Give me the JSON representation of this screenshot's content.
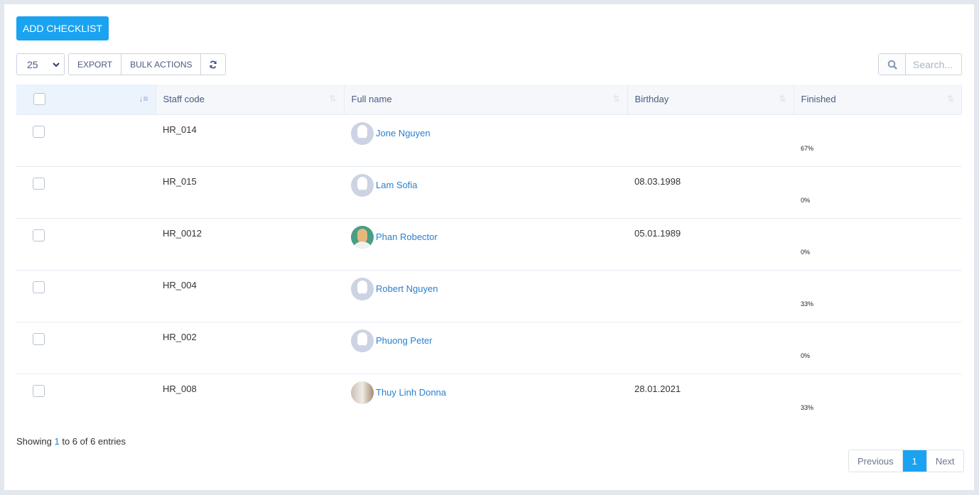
{
  "toolbar": {
    "add_label": "ADD CHECKLIST",
    "page_size": "25",
    "export_label": "EXPORT",
    "bulk_label": "BULK ACTIONS",
    "search_placeholder": "Search..."
  },
  "table": {
    "columns": [
      "Staff code",
      "Full name",
      "Birthday",
      "Finished"
    ],
    "rows": [
      {
        "code": "HR_014",
        "name": "Jone Nguyen",
        "avatar": "default",
        "birthday": "",
        "finished": "67%"
      },
      {
        "code": "HR_015",
        "name": "Lam Sofia",
        "avatar": "default",
        "birthday": "08.03.1998",
        "finished": "0%"
      },
      {
        "code": "HR_0012",
        "name": "Phan Robector",
        "avatar": "illustration",
        "birthday": "05.01.1989",
        "finished": "0%"
      },
      {
        "code": "HR_004",
        "name": "Robert Nguyen",
        "avatar": "default",
        "birthday": "",
        "finished": "33%"
      },
      {
        "code": "HR_002",
        "name": "Phuong Peter",
        "avatar": "default",
        "birthday": "",
        "finished": "0%"
      },
      {
        "code": "HR_008",
        "name": "Thuy Linh Donna",
        "avatar": "photo",
        "birthday": "28.01.2021",
        "finished": "33%"
      }
    ]
  },
  "footer": {
    "showing": "Showing ",
    "from": "1",
    "rest": " to 6 of 6 entries",
    "prev": "Previous",
    "page": "1",
    "next": "Next"
  },
  "colors": {
    "accent": "#1aa3f0",
    "link": "#2a7fd0"
  }
}
